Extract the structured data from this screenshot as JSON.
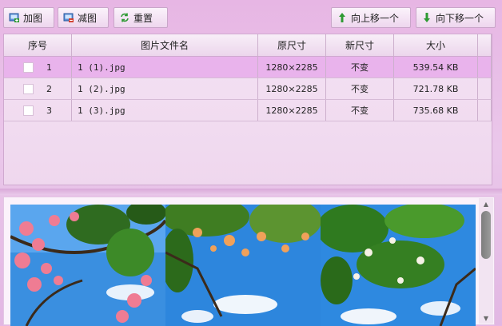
{
  "toolbar": {
    "add_label": "加图",
    "remove_label": "减图",
    "reset_label": "重置",
    "move_up_label": "向上移一个",
    "move_down_label": "向下移一个"
  },
  "table": {
    "headers": [
      "序号",
      "图片文件名",
      "原尺寸",
      "新尺寸",
      "大小"
    ],
    "rows": [
      {
        "index": "1",
        "filename": "1 (1).jpg",
        "original_size": "1280×2285",
        "new_size": "不变",
        "file_size": "539.54 KB",
        "selected": true
      },
      {
        "index": "2",
        "filename": "1 (2).jpg",
        "original_size": "1280×2285",
        "new_size": "不变",
        "file_size": "721.78 KB",
        "selected": false
      },
      {
        "index": "3",
        "filename": "1 (3).jpg",
        "original_size": "1280×2285",
        "new_size": "不变",
        "file_size": "735.68 KB",
        "selected": false
      }
    ]
  },
  "colors": {
    "selected_row": "#e9b3ec",
    "window_bg": "#e7b6e4",
    "accent_green": "#2e9a33",
    "accent_red": "#d03a2a"
  },
  "icons": [
    "add-image-icon",
    "remove-image-icon",
    "reset-icon",
    "arrow-up-icon",
    "arrow-down-icon"
  ]
}
